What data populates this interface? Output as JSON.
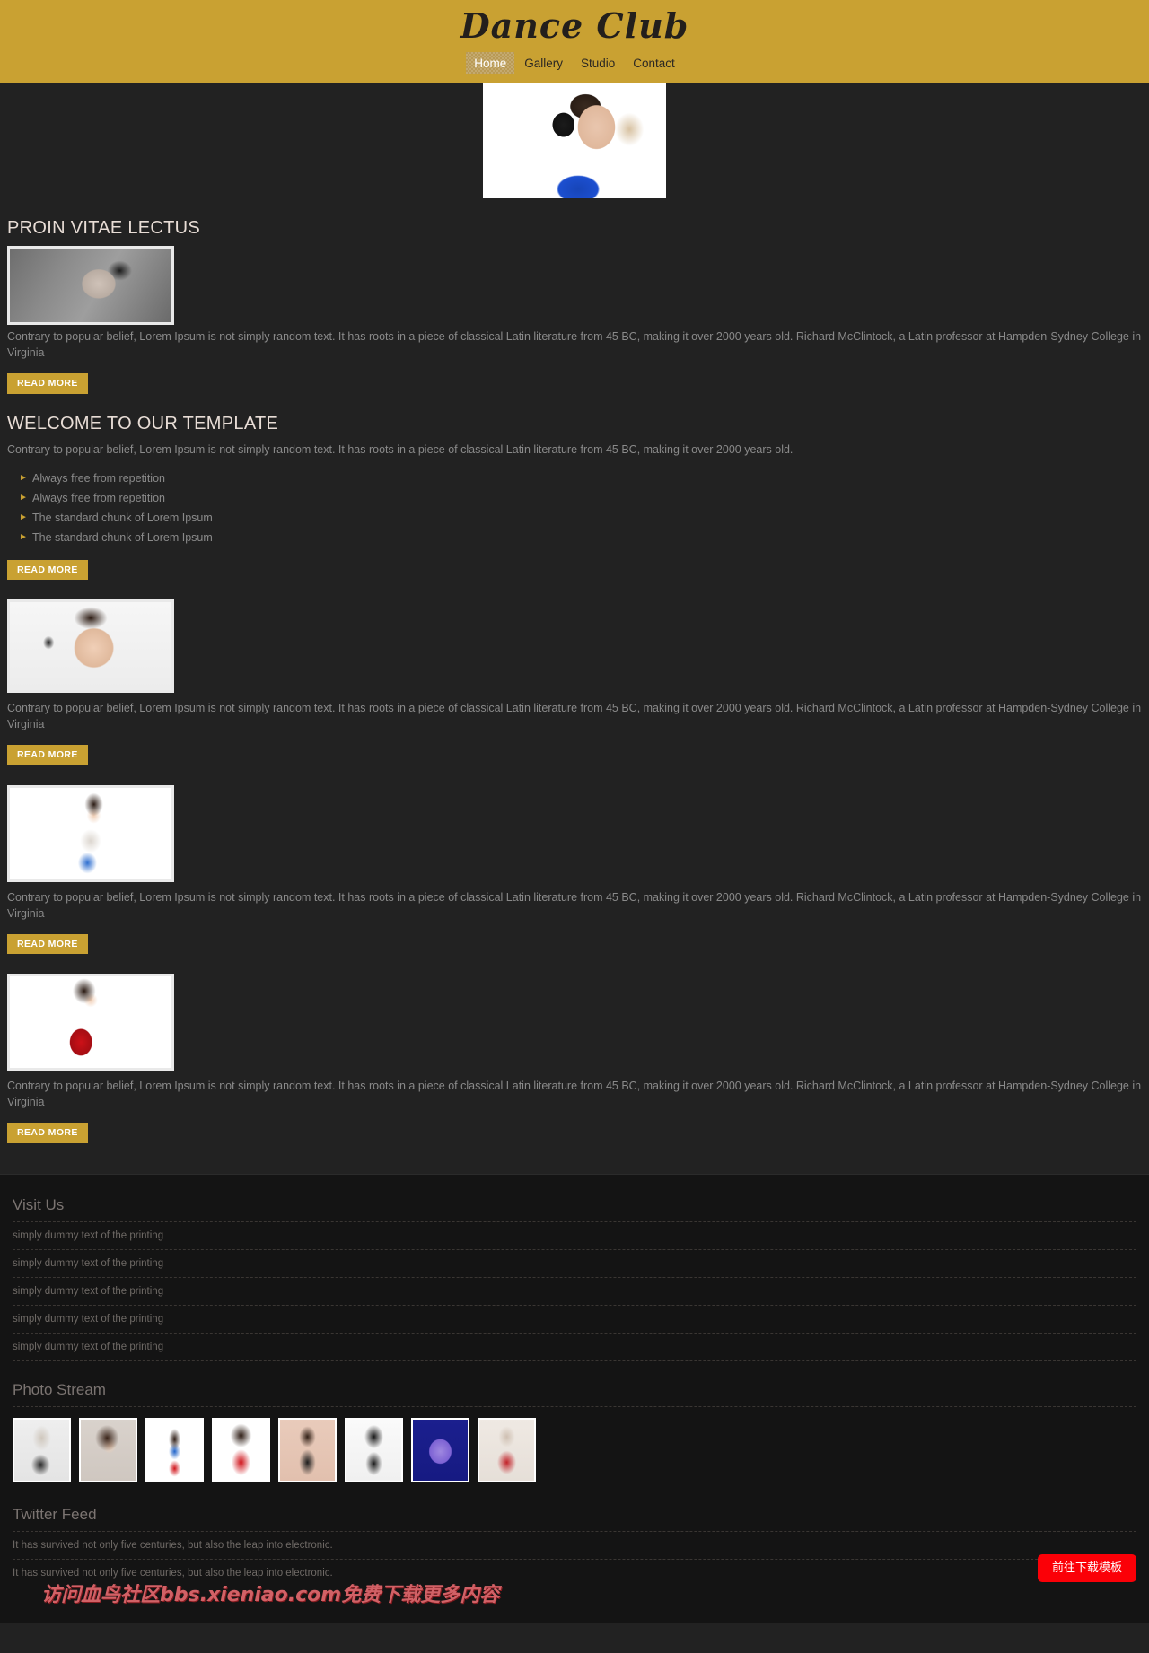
{
  "site": {
    "brand": "Dance Club",
    "nav": [
      {
        "label": "Home",
        "active": true
      },
      {
        "label": "Gallery",
        "active": false
      },
      {
        "label": "Studio",
        "active": false
      },
      {
        "label": "Contact",
        "active": false
      }
    ]
  },
  "colors": {
    "header_gold": "#c9a132",
    "page_dark": "#222222",
    "footer_dark": "#141414",
    "download_red": "#fb0007",
    "heading_light": "#e8ddd6"
  },
  "main": {
    "section1": {
      "title": "PROIN VITAE LECTUS",
      "image": "portrait-grayscale-woman",
      "text": "Contrary to popular belief, Lorem Ipsum is not simply random text. It has roots in a piece of classical Latin literature from 45 BC, making it over 2000 years old. Richard McClintock, a Latin professor at Hampden-Sydney College in Virginia",
      "button": "READ MORE"
    },
    "section2": {
      "title": "WELCOME TO OUR TEMPLATE",
      "text": "Contrary to popular belief, Lorem Ipsum is not simply random text. It has roots in a piece of classical Latin literature from 45 BC, making it over 2000 years old.",
      "list": [
        "Always free from repetition",
        "Always free from repetition",
        "The standard chunk of Lorem Ipsum",
        "The standard chunk of Lorem Ipsum"
      ],
      "button": "READ MORE"
    },
    "section3": {
      "image": "portrait-woman-headset",
      "text": "Contrary to popular belief, Lorem Ipsum is not simply random text. It has roots in a piece of classical Latin literature from 45 BC, making it over 2000 years old. Richard McClintock, a Latin professor at Hampden-Sydney College in Virginia",
      "button": "READ MORE"
    },
    "section4": {
      "image": "portrait-dancer-blue-skirt",
      "text": "Contrary to popular belief, Lorem Ipsum is not simply random text. It has roots in a piece of classical Latin literature from 45 BC, making it over 2000 years old. Richard McClintock, a Latin professor at Hampden-Sydney College in Virginia",
      "button": "READ MORE"
    },
    "section5": {
      "image": "portrait-dancer-red-dress",
      "text": "Contrary to popular belief, Lorem Ipsum is not simply random text. It has roots in a piece of classical Latin literature from 45 BC, making it over 2000 years old. Richard McClintock, a Latin professor at Hampden-Sydney College in Virginia",
      "button": "READ MORE"
    },
    "hero_image": "woman-with-headphones-blue-jacket"
  },
  "footer": {
    "visit_us": {
      "title": "Visit Us",
      "items": [
        "simply dummy text of the printing",
        "simply dummy text of the printing",
        "simply dummy text of the printing",
        "simply dummy text of the printing",
        "simply dummy text of the printing"
      ]
    },
    "photo_stream": {
      "title": "Photo Stream",
      "items": [
        "photo-blonde-dancer",
        "photo-brunette-microphone",
        "photo-blue-red-dress",
        "photo-red-dress",
        "photo-black-dress",
        "photo-overalls",
        "photo-purple-costume",
        "photo-red-polka-dress"
      ]
    },
    "twitter_feed": {
      "title": "Twitter Feed",
      "items": [
        "It has survived not only five centuries, but also the leap into electronic.",
        "It has survived not only five centuries, but also the leap into electronic."
      ]
    }
  },
  "overlay": {
    "download_button": "前往下载模板",
    "watermark": "访问血鸟社区bbs.xieniao.com免费下载更多内容"
  }
}
